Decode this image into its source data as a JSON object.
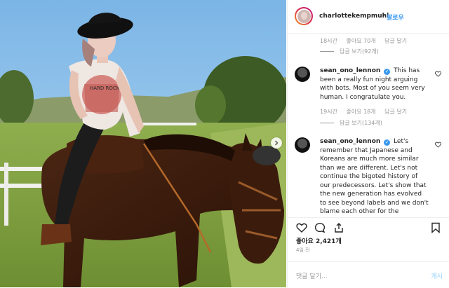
{
  "post": {
    "username": "charlottekempmuhl",
    "dot": "•",
    "follow_label": "팔로우",
    "likes": "좋아요 2,421개",
    "date": "4일 전",
    "comment_placeholder": "댓글 달기...",
    "post_label": "게시"
  },
  "comments": [
    {
      "time": "18시간",
      "likes": "좋아요 70개",
      "reply_label": "답글 달기",
      "view_replies": "답글 보기(92개)"
    },
    {
      "username": "sean_ono_lennon",
      "text": "This has been a really fun night arguing with bots. Most of you seem very human. I congratulate you.",
      "time": "19시간",
      "likes": "좋아요 18개",
      "reply_label": "답글 달기",
      "view_replies": "답글 보기(134개)"
    },
    {
      "username": "sean_ono_lennon",
      "text": "Let's remember that Japanese and Koreans are much more similar than we are different. Let's not continue the bigoted history of our predecessors. Let's show that the new generation has evolved to see beyond labels and we don't blame each other for the"
    }
  ],
  "photo": {
    "shirt_text": "HARD ROCK",
    "icons": {
      "next": "chevron-right-icon",
      "verified": "verified-badge-icon",
      "heart": "heart-icon",
      "comment": "comment-icon",
      "share": "share-icon",
      "save": "bookmark-icon",
      "more": "more-icon"
    }
  },
  "colors": {
    "link_blue": "#3897f0",
    "muted_gray": "#999999",
    "sky": "#8ec2ea"
  }
}
